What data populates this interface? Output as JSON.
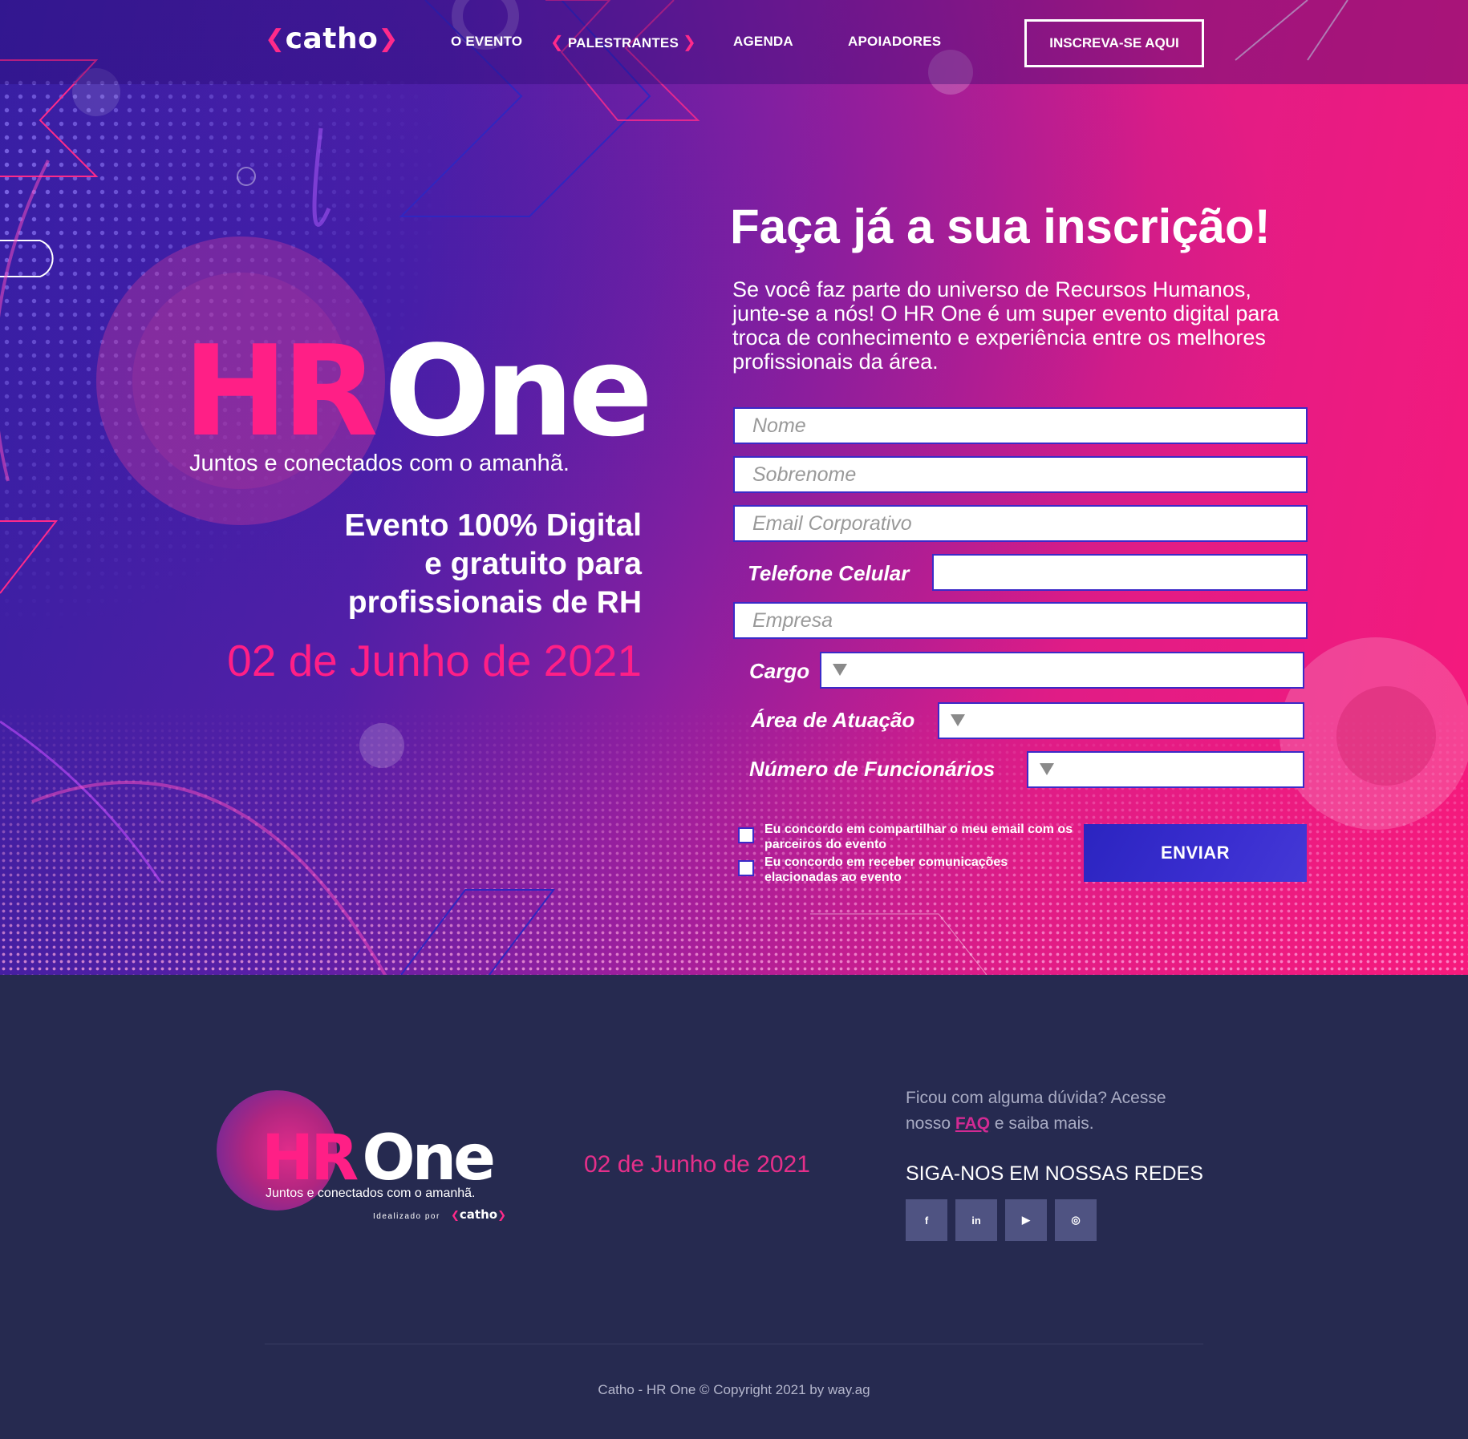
{
  "nav": {
    "logo_text": "catho",
    "items": [
      {
        "label": "O EVENTO"
      },
      {
        "label": "PALESTRANTES"
      },
      {
        "label": "AGENDA"
      },
      {
        "label": "APOIADORES"
      }
    ],
    "cta_label": "INSCREVA-SE AQUI"
  },
  "hero": {
    "brand_hr": "HR",
    "brand_one": "One",
    "tagline": "Juntos e conectados com o amanhã.",
    "digital_line1": "Evento 100% Digital",
    "digital_line2": "e gratuito para",
    "digital_line3": "profissionais de RH",
    "date": "02 de Junho de 2021"
  },
  "form": {
    "title": "Faça já a sua inscrição!",
    "description": "Se você faz parte do universo de Recursos Humanos, junte-se a nós! O HR One é um super evento digital para troca de conhecimento e experiência entre os melhores profissionais da área.",
    "name_placeholder": "Nome",
    "surname_placeholder": "Sobrenome",
    "email_placeholder": "Email Corporativo",
    "phone_label": "Telefone Celular",
    "company_placeholder": "Empresa",
    "cargo_label": "Cargo",
    "area_label": "Área de Atuação",
    "employees_label": "Número de Funcionários",
    "consent_share": "Eu concordo em compartilhar o meu email com os parceiros do evento",
    "consent_comms": "Eu concordo em receber comunicações elacionadas ao evento",
    "submit_label": "ENVIAR"
  },
  "footer": {
    "brand_hr": "HR",
    "brand_one": "One",
    "tagline": "Juntos e conectados com o amanhã.",
    "idealized_by": "Idealizado por",
    "idealized_brand": "catho",
    "date": "02 de Junho de 2021",
    "faq_prefix": "Ficou com alguma dúvida? Acesse nosso ",
    "faq_link": "FAQ",
    "faq_suffix": " e saiba mais.",
    "follow_title": "SIGA-NOS EM NOSSAS REDES",
    "social": [
      {
        "icon": "facebook-icon",
        "glyph": "f"
      },
      {
        "icon": "linkedin-icon",
        "glyph": "in"
      },
      {
        "icon": "youtube-icon",
        "glyph": "▶"
      },
      {
        "icon": "instagram-icon",
        "glyph": "◎"
      }
    ],
    "copyright": "Catho - HR One © Copyright 2021 by way.ag"
  },
  "colors": {
    "brand_pink": "#ff1f86",
    "footer_bg": "#262a50",
    "button_blue": "#2b24c0",
    "social_bg": "#4f5382"
  }
}
